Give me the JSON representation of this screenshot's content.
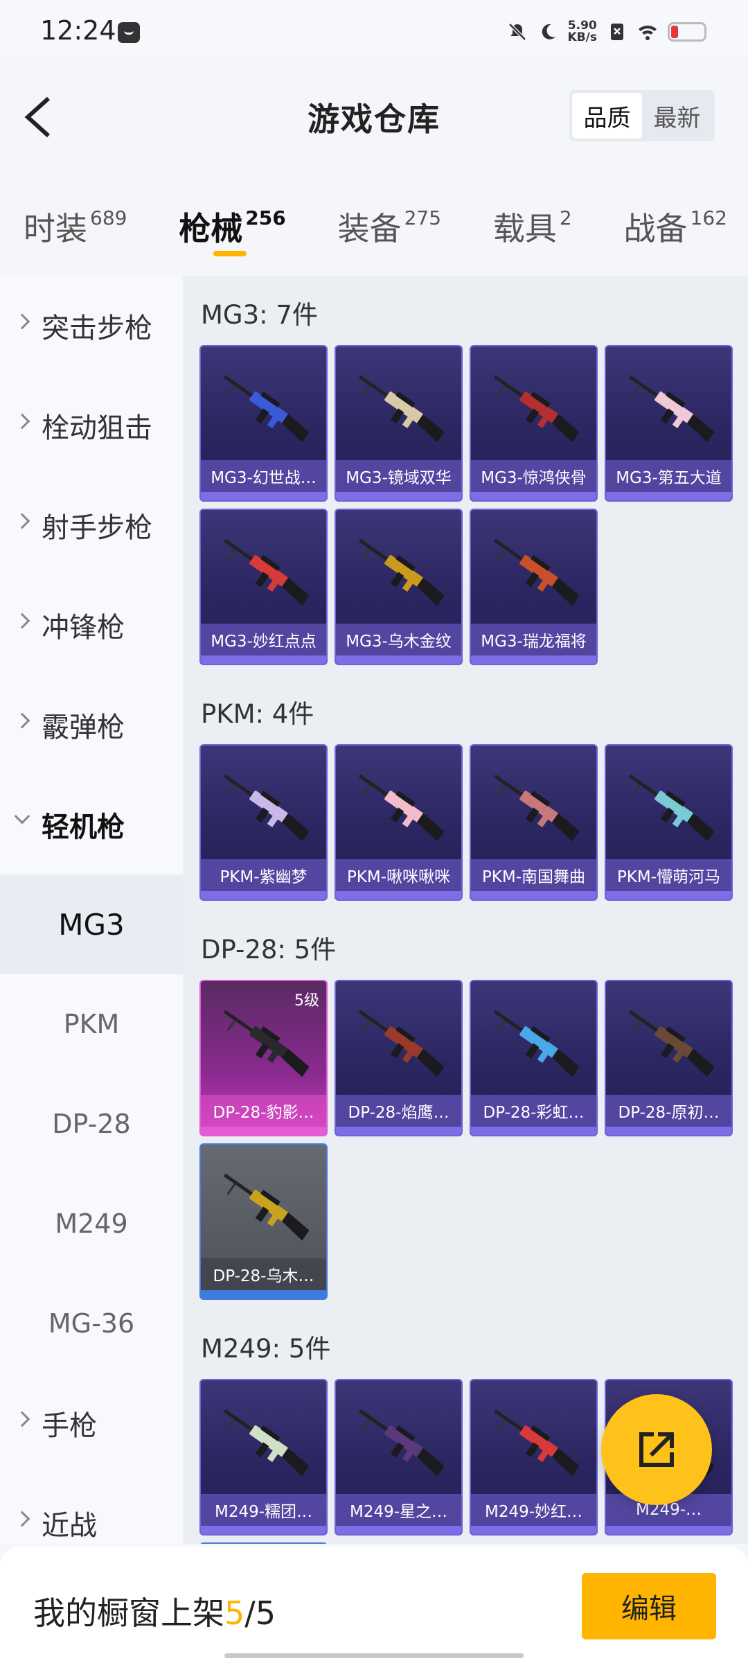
{
  "status_bar": {
    "time": "12:24",
    "net_speed_value": "5.90",
    "net_speed_unit": "KB/s",
    "icons": [
      "message-icon",
      "mute-icon",
      "moon-icon",
      "data-off-icon",
      "wifi-icon",
      "battery-icon"
    ]
  },
  "header": {
    "title": "游戏仓库",
    "back_icon": "back-chevron-icon",
    "sort_options": [
      "品质",
      "最新"
    ],
    "sort_active": "品质"
  },
  "tabs": [
    {
      "label": "时装",
      "count": "689"
    },
    {
      "label": "枪械",
      "count": "256",
      "active": true
    },
    {
      "label": "装备",
      "count": "275"
    },
    {
      "label": "载具",
      "count": "2"
    },
    {
      "label": "战备",
      "count": "162"
    }
  ],
  "sidebar": {
    "items": [
      {
        "label": "突击步枪"
      },
      {
        "label": "栓动狙击"
      },
      {
        "label": "射手步枪"
      },
      {
        "label": "冲锋枪"
      },
      {
        "label": "霰弹枪"
      },
      {
        "label": "轻机枪",
        "expanded": true
      }
    ],
    "subitems": [
      {
        "label": "MG3",
        "active": true
      },
      {
        "label": "PKM"
      },
      {
        "label": "DP-28"
      },
      {
        "label": "M249"
      },
      {
        "label": "MG-36"
      }
    ],
    "more_items": [
      {
        "label": "手枪"
      },
      {
        "label": "近战"
      }
    ]
  },
  "groups": [
    {
      "title": "MG3: 7件",
      "items": [
        {
          "name": "MG3-幻世战…",
          "style": "purple",
          "color": "#3a5bd9"
        },
        {
          "name": "MG3-镜域双华",
          "style": "purple",
          "color": "#d9c9a8"
        },
        {
          "name": "MG3-惊鸿侠骨",
          "style": "purple",
          "color": "#b43030"
        },
        {
          "name": "MG3-第五大道",
          "style": "purple",
          "color": "#f0c8d6"
        },
        {
          "name": "MG3-妙红点点",
          "style": "purple",
          "color": "#d83a3a"
        },
        {
          "name": "MG3-乌木金纹",
          "style": "purple",
          "color": "#c99a1e"
        },
        {
          "name": "MG3-瑞龙福将",
          "style": "purple",
          "color": "#c8502a"
        }
      ]
    },
    {
      "title": "PKM: 4件",
      "items": [
        {
          "name": "PKM-紫幽梦",
          "style": "purple",
          "color": "#c9b8ea"
        },
        {
          "name": "PKM-啾咪啾咪",
          "style": "purple",
          "color": "#f3bccb"
        },
        {
          "name": "PKM-南国舞曲",
          "style": "purple",
          "color": "#c8787a"
        },
        {
          "name": "PKM-懵萌河马",
          "style": "purple",
          "color": "#7cc9d6"
        }
      ]
    },
    {
      "title": "DP-28: 5件",
      "items": [
        {
          "name": "DP-28-豹影…",
          "style": "pink",
          "color": "#2a2a2e",
          "level": "5级"
        },
        {
          "name": "DP-28-焰鹰…",
          "style": "purple",
          "color": "#9a3a2a"
        },
        {
          "name": "DP-28-彩虹…",
          "style": "purple",
          "color": "#4aa8e8"
        },
        {
          "name": "DP-28-原初…",
          "style": "purple",
          "color": "#6a4a36"
        },
        {
          "name": "DP-28-乌木…",
          "style": "grey",
          "color": "#c9a21e"
        }
      ]
    },
    {
      "title": "M249: 5件",
      "items": [
        {
          "name": "M249-糯团…",
          "style": "purple",
          "color": "#cfe0c4"
        },
        {
          "name": "M249-星之…",
          "style": "purple",
          "color": "#5a3a7a"
        },
        {
          "name": "M249-妙红…",
          "style": "purple",
          "color": "#d83a3a"
        },
        {
          "name": "M249-…",
          "style": "purple",
          "color": "#8a5a7a"
        },
        {
          "name": "",
          "style": "grey",
          "color": "#c9a21e"
        }
      ]
    }
  ],
  "fab": {
    "icon": "share-export-icon"
  },
  "bottom_bar": {
    "label": "我的橱窗上架",
    "current": "5",
    "separator": "/",
    "total": "5",
    "edit_label": "编辑"
  }
}
